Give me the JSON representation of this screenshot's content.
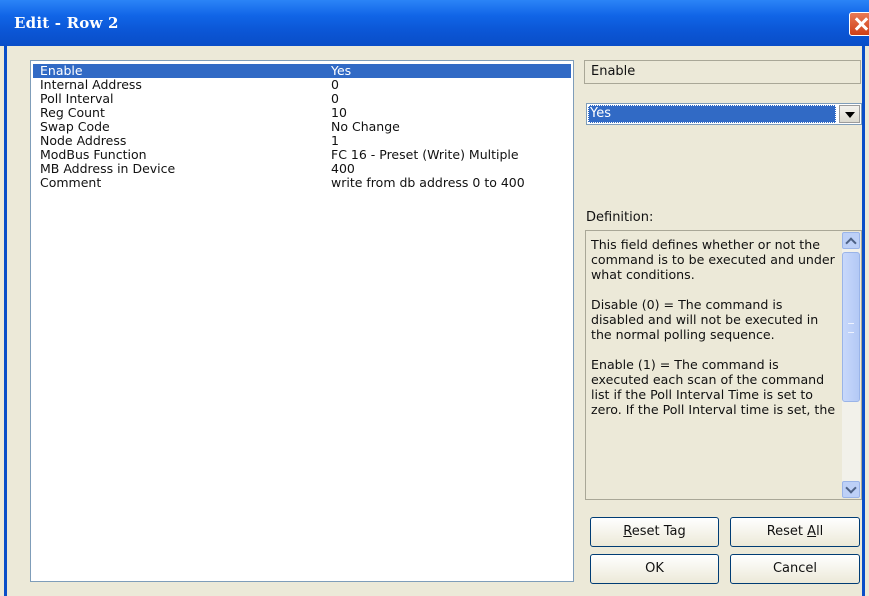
{
  "window": {
    "title": "Edit - Row 2"
  },
  "rows": [
    {
      "name": "Enable",
      "value": "Yes",
      "selected": true
    },
    {
      "name": "Internal Address",
      "value": "0"
    },
    {
      "name": "Poll Interval",
      "value": "0"
    },
    {
      "name": "Reg Count",
      "value": "10"
    },
    {
      "name": "Swap Code",
      "value": "No Change"
    },
    {
      "name": "Node Address",
      "value": "1"
    },
    {
      "name": "ModBus Function",
      "value": "FC 16 - Preset (Write) Multiple"
    },
    {
      "name": "MB Address in Device",
      "value": "400"
    },
    {
      "name": "Comment",
      "value": "write from db address 0 to 400"
    }
  ],
  "editor": {
    "field_name": "Enable",
    "selected_value": "Yes",
    "definition_label": "Definition:",
    "definition_text": "This field defines whether or not the command is to be executed and under what conditions.\n\nDisable (0) = The command is disabled and will not be executed in the normal polling sequence.\n\nEnable (1) = The command is executed each scan of the command list if the Poll Interval Time is set to zero. If the Poll Interval time is set, the"
  },
  "buttons": {
    "reset_tag": {
      "mnemonic": "R",
      "rest": "eset Tag"
    },
    "reset_all": {
      "before": "Reset ",
      "mnemonic": "A",
      "rest": "ll"
    },
    "ok": "OK",
    "cancel": "Cancel"
  }
}
